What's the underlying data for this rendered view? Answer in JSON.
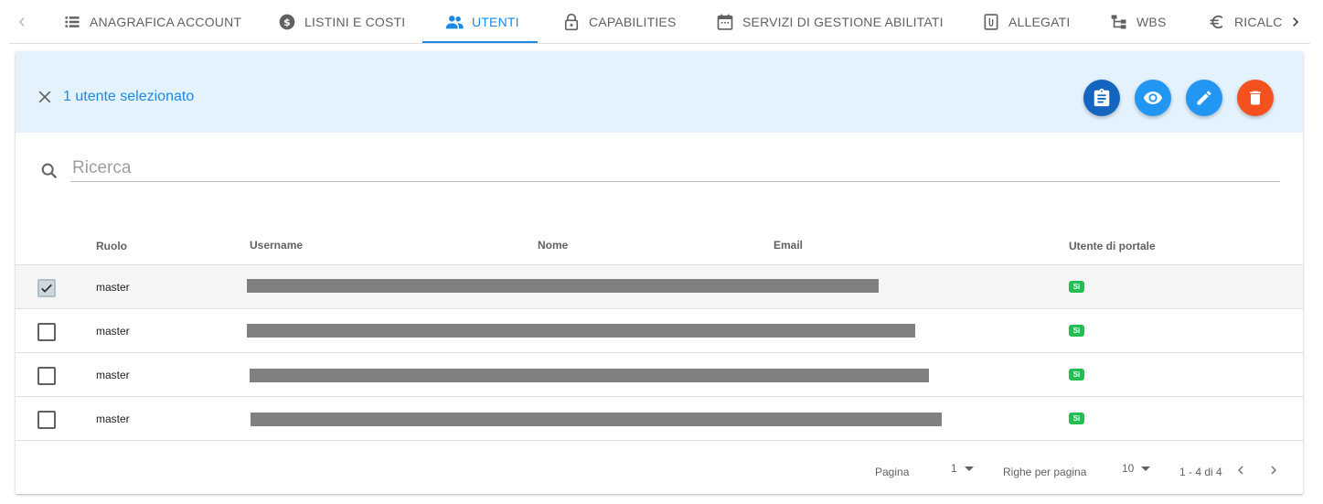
{
  "tabs": [
    {
      "label": "ANAGRAFICA ACCOUNT",
      "icon": "list-icon"
    },
    {
      "label": "LISTINI E COSTI",
      "icon": "dollar-circle-icon"
    },
    {
      "label": "UTENTI",
      "icon": "people-icon",
      "active": true
    },
    {
      "label": "CAPABILITIES",
      "icon": "lock-icon"
    },
    {
      "label": "SERVIZI DI GESTIONE ABILITATI",
      "icon": "calendar-icon"
    },
    {
      "label": "ALLEGATI",
      "icon": "attachment-icon"
    },
    {
      "label": "WBS",
      "icon": "hierarchy-icon"
    },
    {
      "label": "RICALCOLO",
      "icon": "euro-icon"
    }
  ],
  "selection": {
    "text": "1 utente selezionato"
  },
  "search": {
    "placeholder": "Ricerca",
    "value": ""
  },
  "table": {
    "headers": {
      "role": "Ruolo",
      "username": "Username",
      "name": "Nome",
      "email": "Email",
      "portal_user": "Utente di portale"
    },
    "rows": [
      {
        "role": "master",
        "portal_user": "Si",
        "selected": true
      },
      {
        "role": "master",
        "portal_user": "Si",
        "selected": false
      },
      {
        "role": "master",
        "portal_user": "Si",
        "selected": false
      },
      {
        "role": "master",
        "portal_user": "Si",
        "selected": false
      }
    ]
  },
  "pagination": {
    "page_label": "Pagina",
    "page_value": "1",
    "rows_label": "Righe per pagina",
    "rows_value": "10",
    "range": "1 - 4 di 4"
  },
  "colors": {
    "accent": "#1e88e5",
    "selection_bar": "#e3f2fd",
    "delete": "#f4511e",
    "badge": "#1fbf55"
  }
}
